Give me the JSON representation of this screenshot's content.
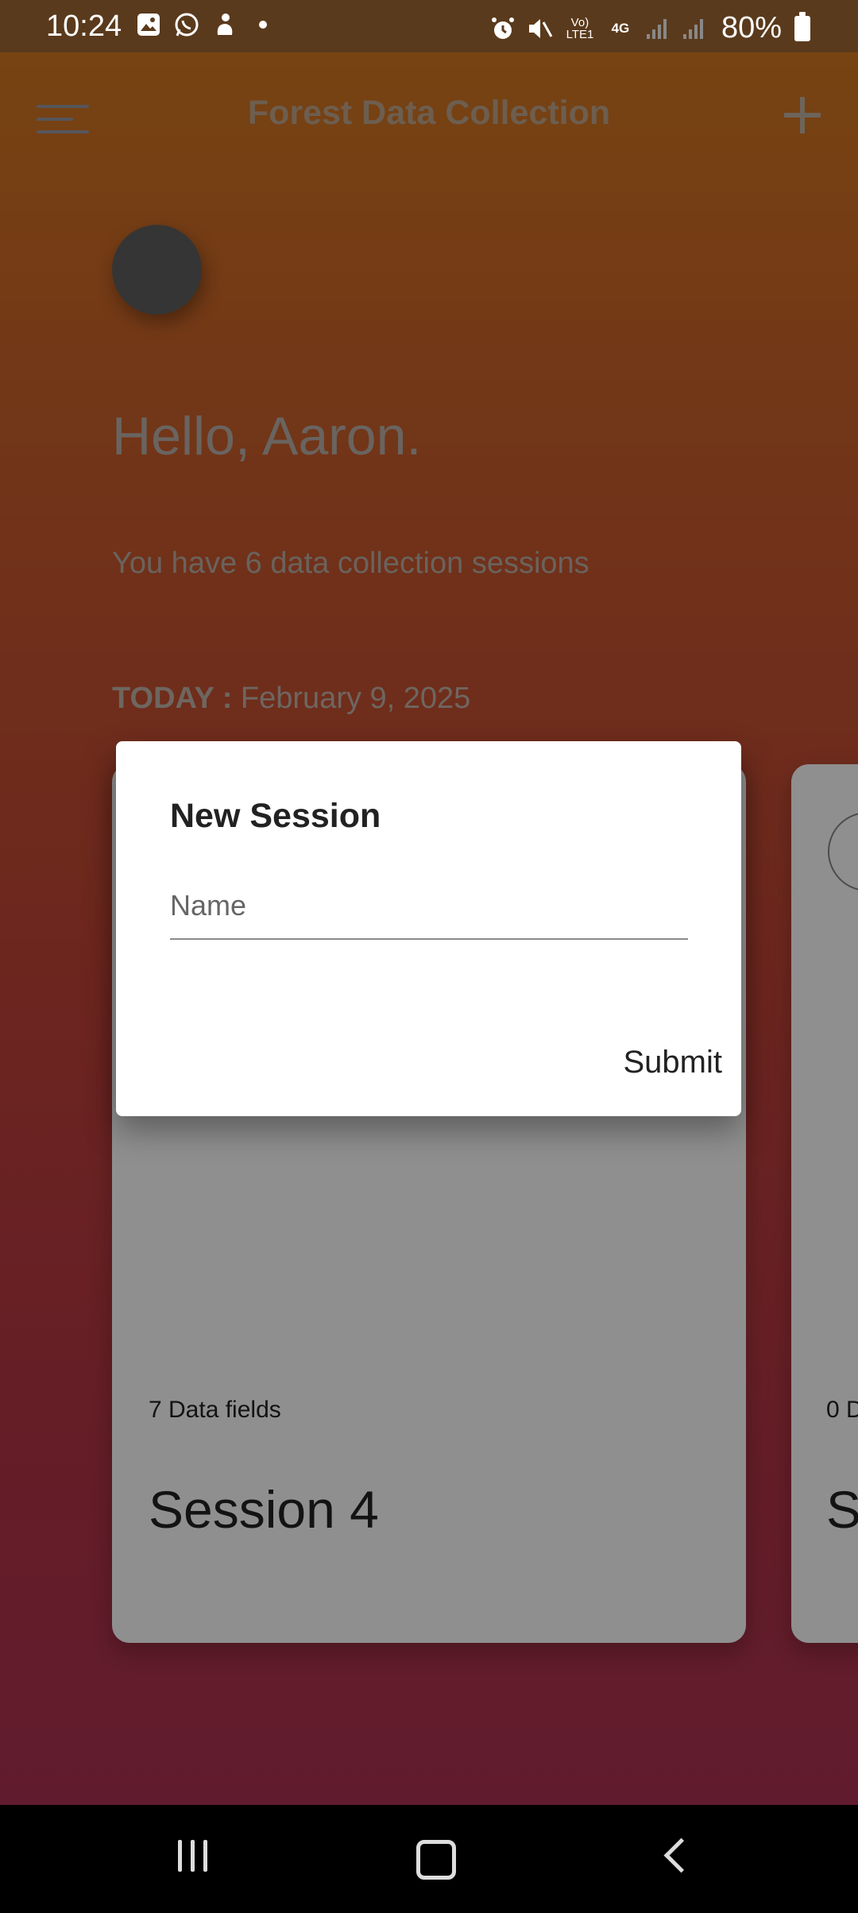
{
  "status_bar": {
    "time": "10:24",
    "battery": "80%",
    "left_icons": [
      "gallery-icon",
      "whatsapp-icon",
      "bixby-icon",
      "dot-icon"
    ],
    "right_icons": [
      "alarm-icon",
      "mute-icon",
      "volte-icon",
      "4g-icon",
      "signal-icon",
      "signal-icon",
      "battery-icon"
    ],
    "volte_label": "Vo) LTE1",
    "network_label": "4G"
  },
  "app_bar": {
    "title": "Forest Data Collection",
    "menu_icon": "menu-icon",
    "add_icon": "plus-icon"
  },
  "home": {
    "greeting": "Hello, Aaron.",
    "sessions_summary": "You have 6 data collection sessions",
    "today_label": "TODAY :",
    "today_date": "February 9, 2025"
  },
  "cards": [
    {
      "fields": "7 Data fields",
      "name": "Session 4"
    },
    {
      "fields": "0 D",
      "name": "S"
    }
  ],
  "dialog": {
    "title": "New Session",
    "name_placeholder": "Name",
    "name_value": "",
    "submit_label": "Submit"
  },
  "nav_bar": {
    "recent_icon": "recent-apps-icon",
    "home_icon": "home-icon",
    "back_icon": "back-icon"
  }
}
